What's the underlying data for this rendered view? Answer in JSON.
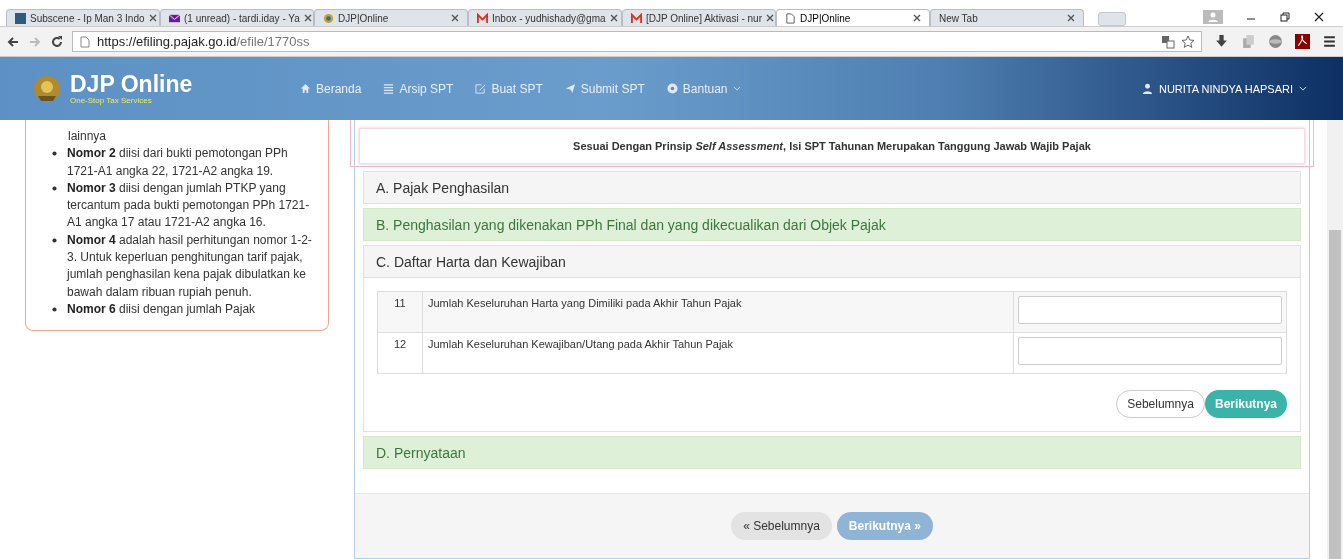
{
  "browser": {
    "tabs": [
      {
        "title": "Subscene - Ip Man 3 Indo",
        "selected": false
      },
      {
        "title": "(1 unread) - tardi.iday - Ya",
        "selected": false
      },
      {
        "title": "DJP|Online",
        "selected": false
      },
      {
        "title": "Inbox - yudhishady@gma",
        "selected": false
      },
      {
        "title": "[DJP Online] Aktivasi - nur",
        "selected": false
      },
      {
        "title": "DJP|Online",
        "selected": true
      },
      {
        "title": "New Tab",
        "selected": false
      }
    ],
    "url_host": "https://efiling.pajak.go.id",
    "url_path": "/efile/1770ss"
  },
  "header": {
    "brand": "DJP Online",
    "tagline": "One-Stop Tax Services",
    "nav": [
      "Beranda",
      "Arsip SPT",
      "Buat SPT",
      "Submit SPT",
      "Bantuan"
    ],
    "user": "NURITA NINDYA HAPSARI"
  },
  "help_panel": {
    "continuation": "lainnya",
    "items": [
      "**Nomor 2** diisi dari bukti pemotongan PPh 1721-A1 angka 22, 1721-A2 angka 19.",
      "**Nomor 3** diisi dengan jumlah PTKP yang tercantum pada bukti pemotongan PPh 1721-A1 angka 17 atau 1721-A2 angka 16.",
      "**Nomor 4** adalah hasil perhitungan nomor 1-2-3. Untuk keperluan penghitungan tarif pajak, jumlah penghasilan kena pajak dibulatkan ke bawah dalam ribuan rupiah penuh.",
      "**Nomor 6** diisi dengan jumlah Pajak"
    ]
  },
  "notice": "Sesuai Dengan Prinsip *Self Assessment*, Isi SPT Tahunan Merupakan Tanggung Jawab Wajib Pajak",
  "sections": [
    {
      "title": "A. Pajak Penghasilan",
      "kind": "plain"
    },
    {
      "title": "B. Penghasilan yang dikenakan PPh Final dan yang dikecualikan dari Objek Pajak",
      "kind": "success"
    },
    {
      "title": "C. Daftar Harta dan Kewajiban",
      "kind": "plain",
      "rows": [
        {
          "no": "11",
          "label": "Jumlah Keseluruhan Harta yang Dimiliki pada Akhir Tahun Pajak"
        },
        {
          "no": "12",
          "label": "Jumlah Keseluruhan Kewajiban/Utang pada Akhir Tahun Pajak"
        }
      ],
      "prev": "Sebelumnya",
      "next": "Berikutnya"
    },
    {
      "title": "D. Pernyataan",
      "kind": "success"
    }
  ],
  "footer": {
    "prev": "« Sebelumnya",
    "next": "Berikutnya »",
    "next_disabled": true
  }
}
